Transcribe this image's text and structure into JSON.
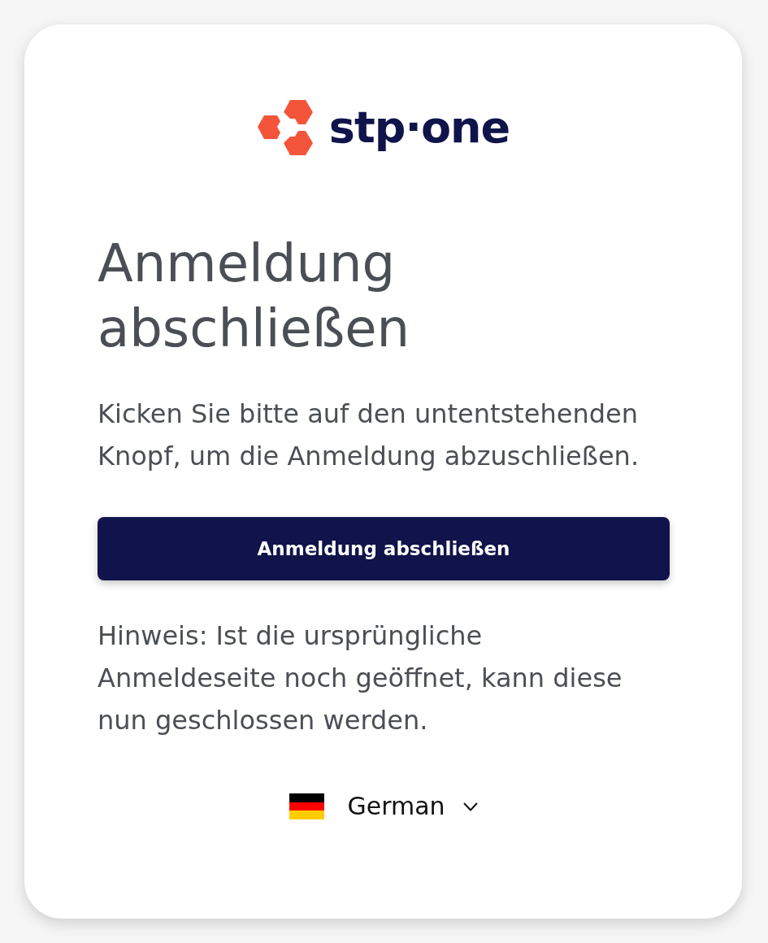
{
  "logo": {
    "wordmark": "stp·one"
  },
  "heading": "Anmeldung abschließen",
  "message": "Kicken Sie bitte auf den untentstehenden Knopf, um die Anmeldung abzuschließen.",
  "primary_button": {
    "label": "Anmeldung abschließen"
  },
  "note": "Hinweis: Ist die ursprüngliche Anmeldeseite noch geöffnet, kann diese nun geschlossen werden.",
  "language_selector": {
    "value": "German"
  }
}
